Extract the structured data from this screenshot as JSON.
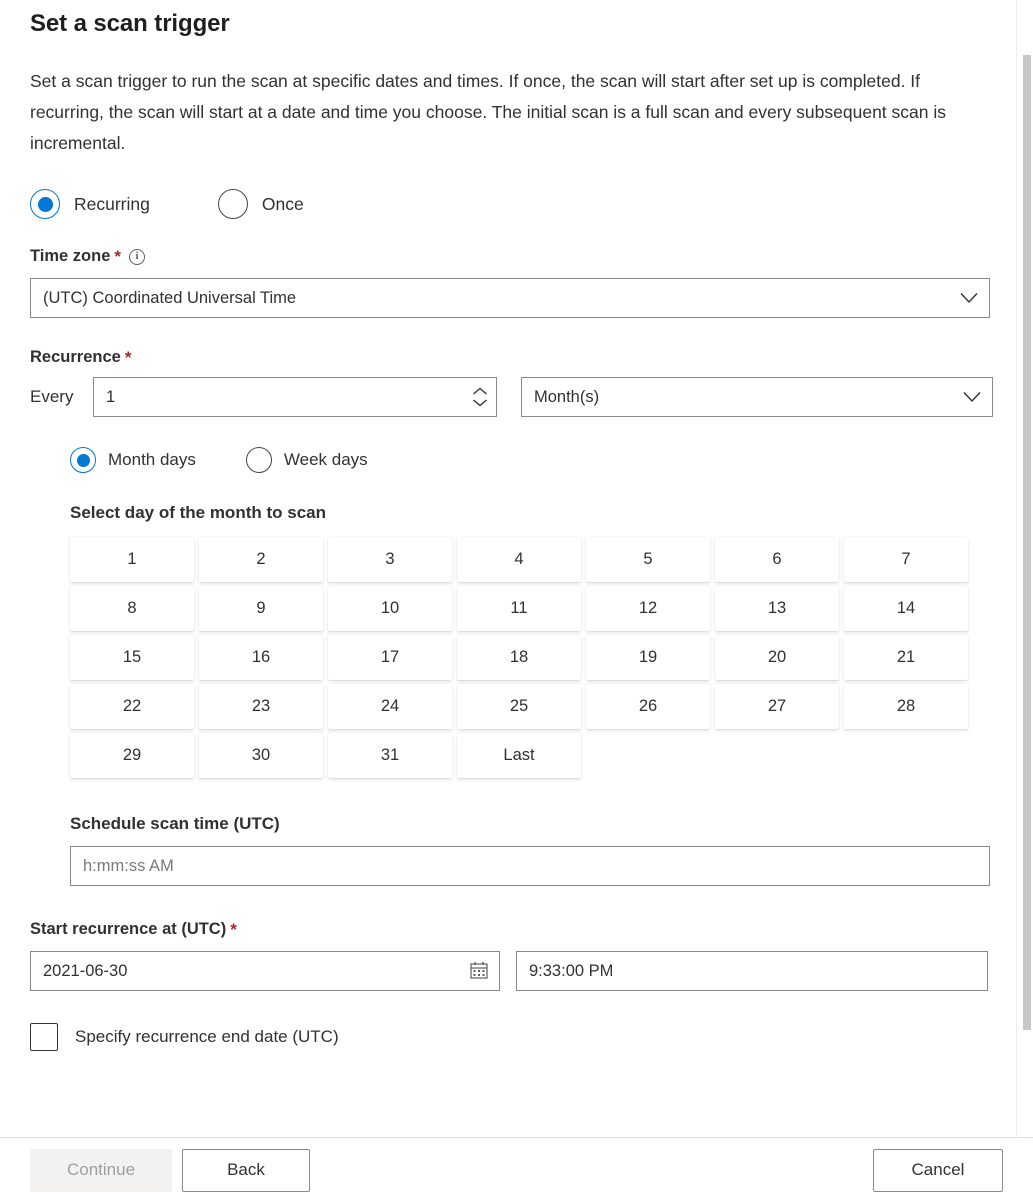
{
  "page": {
    "title": "Set a scan trigger",
    "description": "Set a scan trigger to run the scan at specific dates and times. If once, the scan will start after set up is completed. If recurring, the scan will start at a date and time you choose. The initial scan is a full scan and every subsequent scan is incremental."
  },
  "trigger_type": {
    "options": [
      {
        "label": "Recurring",
        "selected": true
      },
      {
        "label": "Once",
        "selected": false
      }
    ]
  },
  "time_zone": {
    "label": "Time zone",
    "required_marker": "*",
    "info_glyph": "i",
    "value": "(UTC) Coordinated Universal Time"
  },
  "recurrence": {
    "label": "Recurrence",
    "required_marker": "*",
    "every_label": "Every",
    "interval_value": "1",
    "unit_value": "Month(s)",
    "mode_options": [
      {
        "label": "Month days",
        "selected": true
      },
      {
        "label": "Week days",
        "selected": false
      }
    ],
    "grid_caption": "Select day of the month to scan",
    "days": [
      "1",
      "2",
      "3",
      "4",
      "5",
      "6",
      "7",
      "8",
      "9",
      "10",
      "11",
      "12",
      "13",
      "14",
      "15",
      "16",
      "17",
      "18",
      "19",
      "20",
      "21",
      "22",
      "23",
      "24",
      "25",
      "26",
      "27",
      "28",
      "29",
      "30",
      "31",
      "Last"
    ]
  },
  "schedule_time": {
    "label": "Schedule scan time (UTC)",
    "placeholder": "h:mm:ss AM",
    "value": ""
  },
  "start_recurrence": {
    "label": "Start recurrence at (UTC)",
    "required_marker": "*",
    "date_value": "2021-06-30",
    "time_value": "9:33:00 PM"
  },
  "end_date_checkbox": {
    "label": "Specify recurrence end date (UTC)",
    "checked": false
  },
  "footer": {
    "continue_label": "Continue",
    "back_label": "Back",
    "cancel_label": "Cancel"
  },
  "colors": {
    "accent": "#0078d4",
    "required": "#a4262c",
    "text": "#323130",
    "border": "#8a8886",
    "disabled_bg": "#f3f2f1",
    "disabled_text": "#a19f9d"
  }
}
